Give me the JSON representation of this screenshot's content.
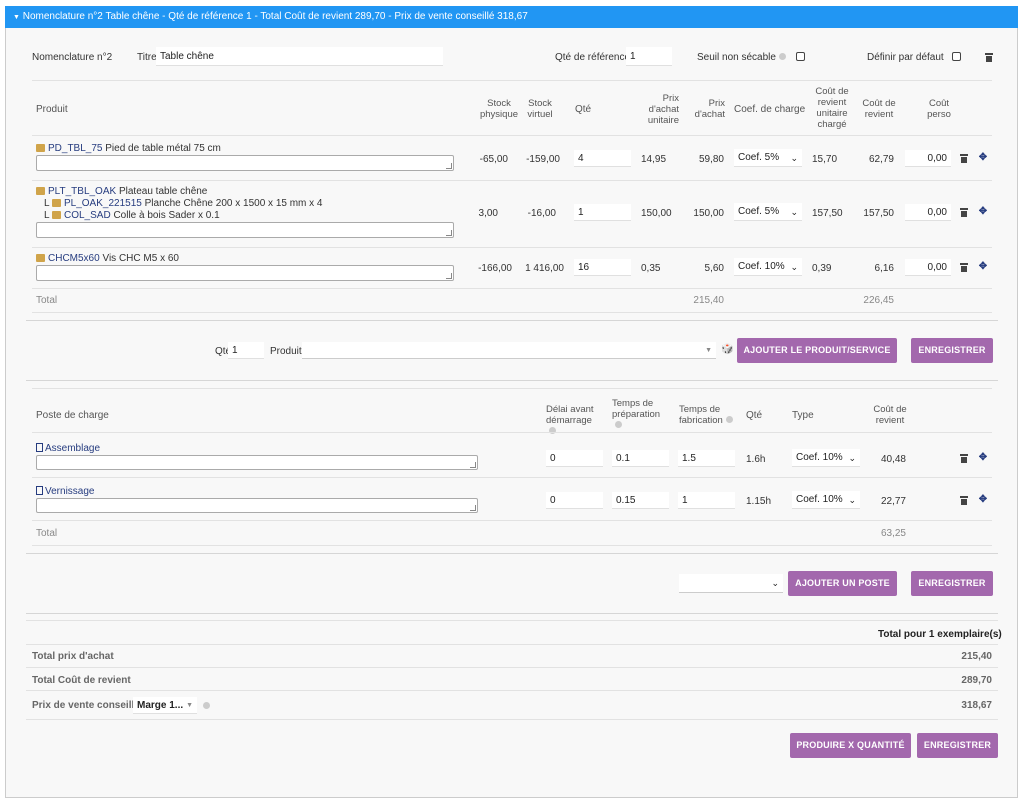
{
  "header": {
    "title": "Nomenclature n°2 Table chêne - Qté de référence 1 - Total Coût de revient 289,70 - Prix de vente conseillé 318,67"
  },
  "nomen": {
    "label": "Nomenclature n°2",
    "titre_label": "Titre",
    "titre_value": "Table chêne",
    "qte_ref_label": "Qté de référence",
    "qte_ref_value": "1",
    "seuil_label": "Seuil non sécable",
    "defaut_label": "Définir par défaut"
  },
  "products_table": {
    "headers": {
      "produit": "Produit",
      "stock_physique": "Stock physique",
      "stock_virtuel": "Stock virtuel",
      "qte": "Qté",
      "prix_achat_unitaire": "Prix d'achat unitaire",
      "prix_achat": "Prix d'achat",
      "coef": "Coef. de charge",
      "cout_unitaire": "Coût de revient unitaire chargé",
      "cout_revient": "Coût de revient",
      "cout_perso": "Coût perso"
    },
    "rows": [
      {
        "ref": "PD_TBL_75",
        "name": "Pied de table métal 75 cm",
        "subs": [],
        "stock_physique": "-65,00",
        "stock_virtuel": "-159,00",
        "qte": "4",
        "prix_unit": "14,95",
        "prix_achat": "59,80",
        "coef": "Coef. 5%",
        "cout_unit": "15,70",
        "cout_revient": "62,79",
        "cout_perso": "0,00"
      },
      {
        "ref": "PLT_TBL_OAK",
        "name": "Plateau table chêne",
        "subs": [
          {
            "prefix": "L",
            "ref": "PL_OAK_221515",
            "name": "Planche Chêne 200 x 1500 x 15 mm x 4"
          },
          {
            "prefix": "L",
            "ref": "COL_SAD",
            "name": "Colle à bois Sader x 0.1"
          }
        ],
        "stock_physique": "3,00",
        "stock_virtuel": "-16,00",
        "qte": "1",
        "prix_unit": "150,00",
        "prix_achat": "150,00",
        "coef": "Coef. 5%",
        "cout_unit": "157,50",
        "cout_revient": "157,50",
        "cout_perso": "0,00"
      },
      {
        "ref": "CHCM5x60",
        "name": "Vis CHC M5 x 60",
        "subs": [],
        "stock_physique": "-166,00",
        "stock_virtuel": "1 416,00",
        "qte": "16",
        "prix_unit": "0,35",
        "prix_achat": "5,60",
        "coef": "Coef. 10%",
        "cout_unit": "0,39",
        "cout_revient": "6,16",
        "cout_perso": "0,00"
      }
    ],
    "total_label": "Total",
    "total_prix_achat": "215,40",
    "total_cout_revient": "226,45"
  },
  "add_product": {
    "qte_label": "Qté",
    "qte_value": "1",
    "produit_label": "Produit",
    "add_button": "AJOUTER LE PRODUIT/SERVICE",
    "save_button": "ENREGISTRER"
  },
  "charges_table": {
    "headers": {
      "poste": "Poste de charge",
      "delai": "Délai avant démarrage",
      "temps_prep": "Temps de préparation",
      "temps_fab": "Temps de fabrication",
      "qte": "Qté",
      "type": "Type",
      "cout": "Coût de revient"
    },
    "rows": [
      {
        "name": "Assemblage",
        "delai": "0",
        "prep": "0.1",
        "fab": "1.5",
        "qte": "1.6h",
        "type": "Coef. 10%",
        "cout": "40,48"
      },
      {
        "name": "Vernissage",
        "delai": "0",
        "prep": "0.15",
        "fab": "1",
        "qte": "1.15h",
        "type": "Coef. 10%",
        "cout": "22,77"
      }
    ],
    "total_label": "Total",
    "total_cout": "63,25"
  },
  "add_poste": {
    "add_button": "AJOUTER UN POSTE",
    "save_button": "ENREGISTRER"
  },
  "summary": {
    "header": "Total pour 1 exemplaire(s)",
    "rows": [
      {
        "label": "Total prix d'achat",
        "value": "215,40"
      },
      {
        "label": "Total Coût de revient",
        "value": "289,70"
      }
    ],
    "pv_label": "Prix de vente conseillé",
    "pv_select": "Marge 1...",
    "pv_value": "318,67"
  },
  "footer": {
    "produire_button": "PRODUIRE X QUANTITÉ",
    "save_button": "ENREGISTRER"
  },
  "colors": {
    "header_bg": "#2196f3",
    "button_bg": "#a368ad",
    "link": "#263c7f"
  }
}
